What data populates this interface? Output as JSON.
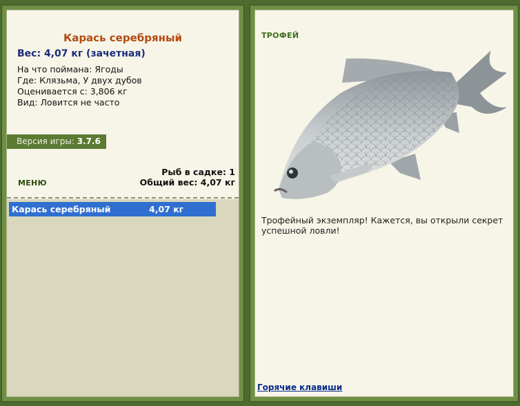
{
  "left_panel": {
    "fish_name": "Карась серебряный",
    "weight_line": "Вес: 4,07 кг (зачетная)",
    "bait": "На что поймана: Ягоды",
    "location": "Где: Клязьма, У двух дубов",
    "valued_from": "Оценивается с: 3,806 кг",
    "kind": "Вид: Ловится не часто",
    "version_label": "Версия игры:",
    "version_value": "3.7.6",
    "menu_label": "МЕНЮ",
    "fish_in_cage": "Рыб в садке: 1",
    "total_weight": "Общий вес: 4,07 кг",
    "catch_list": [
      {
        "name": "Карась серебряный",
        "weight": "4,07 кг"
      }
    ]
  },
  "right_panel": {
    "trophy_label": "ТРОФЕЙ",
    "image_icon": "crucian-carp-fish-image",
    "trophy_text": "Трофейный экземпляр! Кажется, вы открыли секрет успешной ловли!",
    "hotkeys_label": "Горячие клавиши"
  },
  "colors": {
    "background": "#4d6b2e",
    "panel": "#f6f5e8",
    "title": "#b34a12",
    "selection": "#2f6fd0"
  }
}
